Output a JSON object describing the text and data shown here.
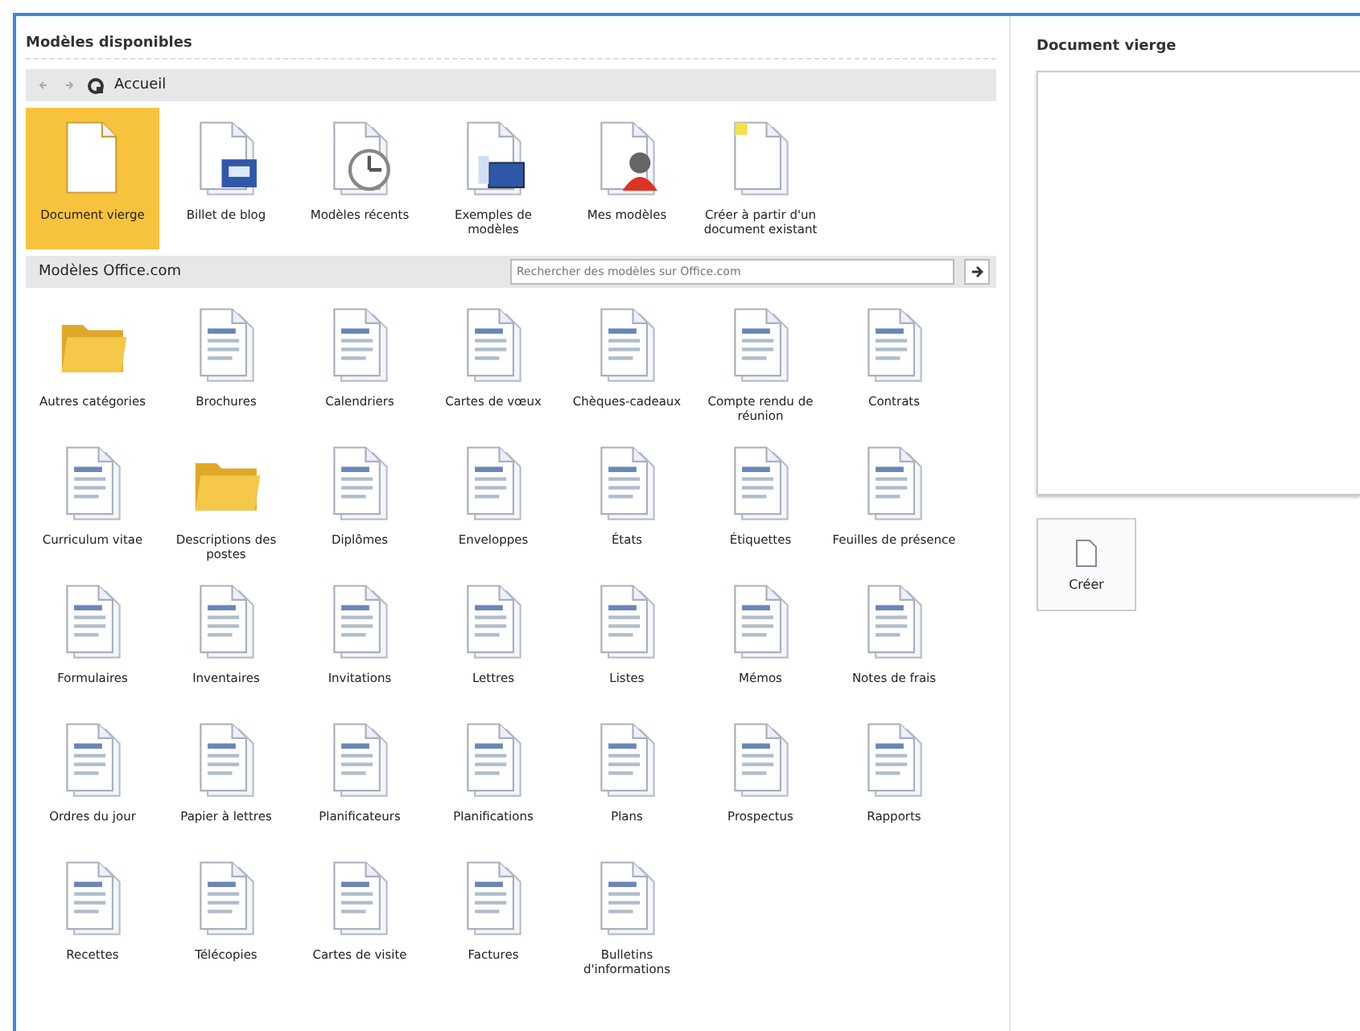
{
  "available": {
    "title": "Modèles disponibles",
    "nav": {
      "back_disabled": true,
      "forward_disabled": true,
      "location": "Accueil"
    },
    "items": [
      {
        "label": "Document vierge",
        "kind": "blank",
        "selected": true
      },
      {
        "label": "Billet de blog",
        "kind": "blog",
        "selected": false
      },
      {
        "label": "Modèles récents",
        "kind": "recent",
        "selected": false
      },
      {
        "label": "Exemples de modèles",
        "kind": "samples",
        "selected": false
      },
      {
        "label": "Mes modèles",
        "kind": "mine",
        "selected": false
      },
      {
        "label": "Créer à partir d'un document existant",
        "kind": "existing",
        "selected": false
      }
    ]
  },
  "office": {
    "title": "Modèles Office.com",
    "search": {
      "placeholder": "Rechercher des modèles sur Office.com"
    },
    "items": [
      {
        "label": "Autres catégories",
        "kind": "folder"
      },
      {
        "label": "Brochures",
        "kind": "document"
      },
      {
        "label": "Calendriers",
        "kind": "document"
      },
      {
        "label": "Cartes de vœux",
        "kind": "document"
      },
      {
        "label": "Chèques-cadeaux",
        "kind": "document"
      },
      {
        "label": "Compte rendu de réunion",
        "kind": "document"
      },
      {
        "label": "Contrats",
        "kind": "document"
      },
      {
        "label": "Curriculum vitae",
        "kind": "document"
      },
      {
        "label": "Descriptions des postes",
        "kind": "folder"
      },
      {
        "label": "Diplômes",
        "kind": "document"
      },
      {
        "label": "Enveloppes",
        "kind": "document"
      },
      {
        "label": "États",
        "kind": "document"
      },
      {
        "label": "Étiquettes",
        "kind": "document"
      },
      {
        "label": "Feuilles de présence",
        "kind": "document"
      },
      {
        "label": "Formulaires",
        "kind": "document"
      },
      {
        "label": "Inventaires",
        "kind": "document"
      },
      {
        "label": "Invitations",
        "kind": "document"
      },
      {
        "label": "Lettres",
        "kind": "document"
      },
      {
        "label": "Listes",
        "kind": "document"
      },
      {
        "label": "Mémos",
        "kind": "document"
      },
      {
        "label": "Notes de frais",
        "kind": "document"
      },
      {
        "label": "Ordres du jour",
        "kind": "document"
      },
      {
        "label": "Papier à lettres",
        "kind": "document"
      },
      {
        "label": "Planificateurs",
        "kind": "document"
      },
      {
        "label": "Planifications",
        "kind": "document"
      },
      {
        "label": "Plans",
        "kind": "document"
      },
      {
        "label": "Prospectus",
        "kind": "document"
      },
      {
        "label": "Rapports",
        "kind": "document"
      },
      {
        "label": "Recettes",
        "kind": "document"
      },
      {
        "label": "Télécopies",
        "kind": "document"
      },
      {
        "label": "Cartes de visite",
        "kind": "document"
      },
      {
        "label": "Factures",
        "kind": "document"
      },
      {
        "label": "Bulletins d'informations",
        "kind": "document"
      }
    ]
  },
  "preview": {
    "title": "Document vierge",
    "create_button": "Créer"
  }
}
